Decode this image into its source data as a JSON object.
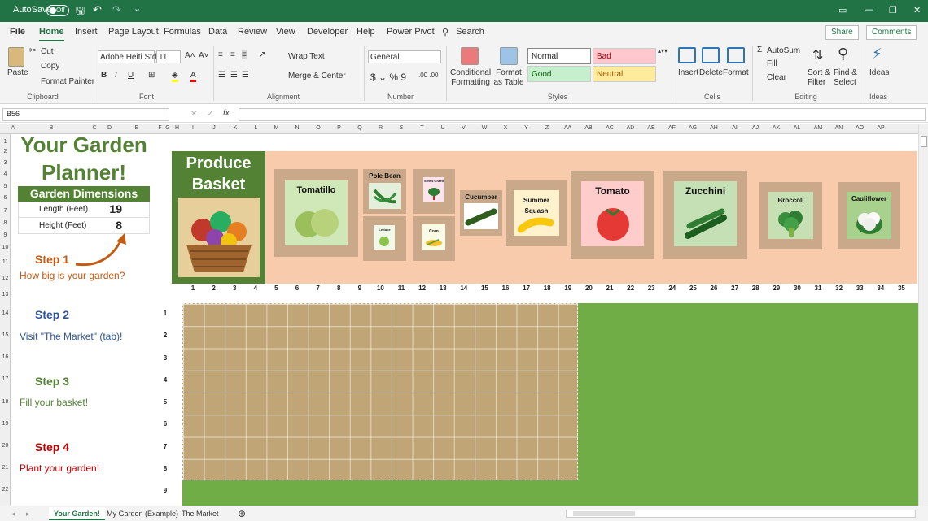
{
  "titlebar": {
    "autosave": "AutoSave",
    "toggle": "Off",
    "win_min": "—",
    "win_max": "❐",
    "win_close": "✕",
    "win_opt": "▭"
  },
  "menu": {
    "file": "File",
    "home": "Home",
    "insert": "Insert",
    "page_layout": "Page Layout",
    "formulas": "Formulas",
    "data": "Data",
    "review": "Review",
    "view": "View",
    "developer": "Developer",
    "help": "Help",
    "power_pivot": "Power Pivot",
    "search": "Search",
    "share": "Share",
    "comments": "Comments"
  },
  "ribbon": {
    "paste": "Paste",
    "cut": "Cut",
    "copy": "Copy",
    "format_painter": "Format Painter",
    "clipboard": "Clipboard",
    "font_name": "Adobe Heiti Std",
    "font_size": "11",
    "font_group": "Font",
    "wrap_text": "Wrap Text",
    "merge_center": "Merge & Center",
    "alignment": "Alignment",
    "number_format": "General",
    "number": "Number",
    "conditional_formatting": "Conditional Formatting",
    "format_as_table": "Format as Table",
    "style_normal": "Normal",
    "style_bad": "Bad",
    "style_good": "Good",
    "style_neutral": "Neutral",
    "styles": "Styles",
    "insert": "Insert",
    "delete": "Delete",
    "format": "Format",
    "cells": "Cells",
    "autosum": "AutoSum",
    "fill": "Fill",
    "clear": "Clear",
    "sort_filter": "Sort & Filter",
    "find_select": "Find & Select",
    "editing": "Editing",
    "ideas": "Ideas",
    "ideas_group": "Ideas"
  },
  "formula_bar": {
    "name_box": "B56",
    "value": ""
  },
  "columns": [
    "A",
    "B",
    "C",
    "D",
    "E",
    "F",
    "G",
    "H",
    "I",
    "J",
    "K",
    "L",
    "M",
    "N",
    "O",
    "P",
    "Q",
    "R",
    "S",
    "T",
    "U",
    "V",
    "W",
    "X",
    "Y",
    "Z",
    "AA",
    "AB",
    "AC",
    "AD",
    "AE",
    "AF",
    "AG",
    "AH",
    "AI",
    "AJ",
    "AK",
    "AL",
    "AM",
    "AN",
    "AO",
    "AP"
  ],
  "rows": [
    "1",
    "2",
    "3",
    "4",
    "5",
    "6",
    "7",
    "8",
    "9",
    "10",
    "11",
    "12",
    "13",
    "14",
    "15",
    "16",
    "17",
    "18",
    "19",
    "20",
    "21",
    "22"
  ],
  "planner": {
    "title1": "Your Garden",
    "title2": "Planner!",
    "dim_header": "Garden Dimensions",
    "length_label": "Length (Feet)",
    "length_value": "19",
    "height_label": "Height (Feet)",
    "height_value": "8",
    "step1": "Step 1",
    "step1_desc": "How big is your garden?",
    "step2": "Step 2",
    "step2_desc": "Visit \"The Market\" (tab)!",
    "step3": "Step 3",
    "step3_desc": "Fill your basket!",
    "step4": "Step 4",
    "step4_desc": "Plant your garden!"
  },
  "basket": {
    "title": "Produce Basket",
    "vegetables": [
      "Tomatillo",
      "Pole Bean",
      "Swiss Chard",
      "Lettuce",
      "Corn",
      "Cucumber",
      "Summer Squash",
      "Tomato",
      "Zucchini",
      "Broccoli",
      "Cauliflower"
    ]
  },
  "col_numbers": [
    "1",
    "2",
    "3",
    "4",
    "5",
    "6",
    "7",
    "8",
    "9",
    "10",
    "11",
    "12",
    "13",
    "14",
    "15",
    "16",
    "17",
    "18",
    "19",
    "20",
    "21",
    "22",
    "23",
    "24",
    "25",
    "26",
    "27",
    "28",
    "29",
    "30",
    "31",
    "32",
    "33",
    "34",
    "35"
  ],
  "row_numbers": [
    "1",
    "2",
    "3",
    "4",
    "5",
    "6",
    "7",
    "8",
    "9"
  ],
  "sheets": [
    "Your Garden!",
    "My Garden (Example)",
    "The Market"
  ],
  "colors": {
    "excel_green": "#217346",
    "planner_green": "#548235",
    "basket_bg": "#f8cbad",
    "soil": "#c0a676",
    "grass": "#70ad47",
    "step4_red": "#c00000",
    "step1_orange": "#c55a11",
    "step2_blue": "#2f5597"
  }
}
